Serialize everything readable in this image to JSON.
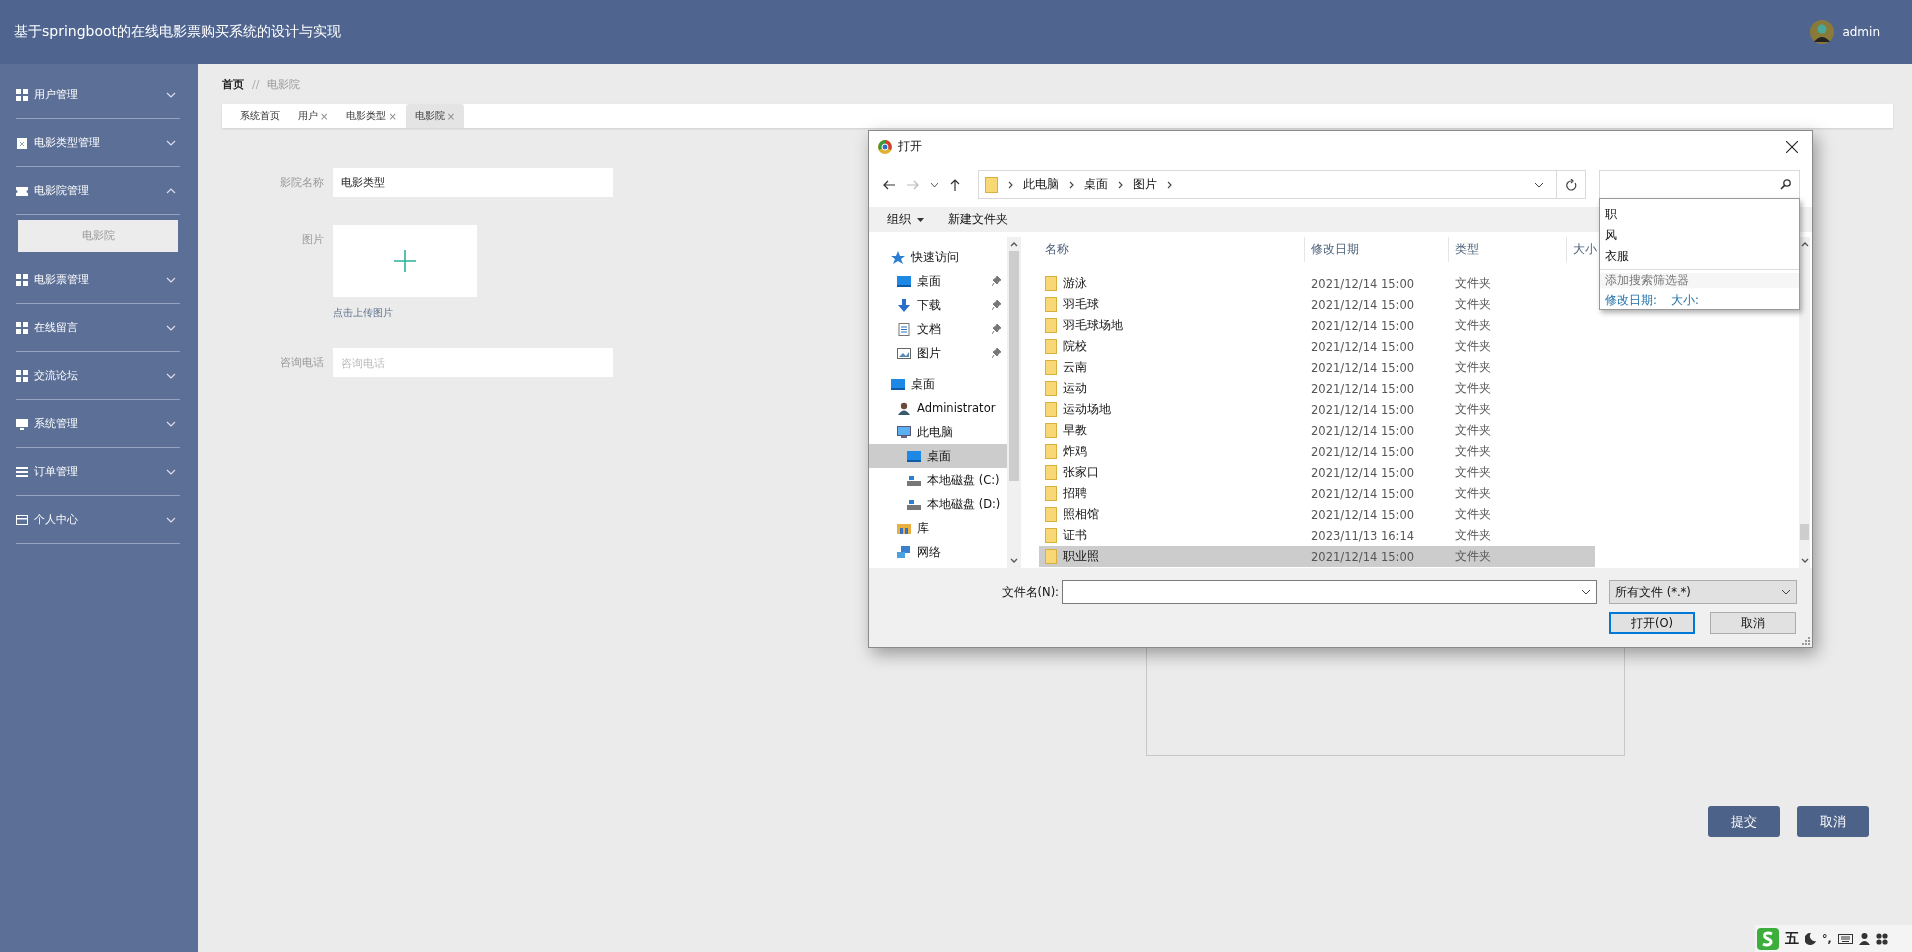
{
  "header": {
    "title": "基于springboot的在线电影票购买系统的设计与实现",
    "user": "admin"
  },
  "sidebar": [
    {
      "label": "用户管理",
      "kind": "grid",
      "expanded": false
    },
    {
      "label": "电影类型管理",
      "kind": "clipboard",
      "expanded": false
    },
    {
      "label": "电影院管理",
      "kind": "ticket",
      "expanded": true,
      "children": [
        {
          "label": "电影院",
          "selected": true
        }
      ]
    },
    {
      "label": "电影票管理",
      "kind": "grid",
      "expanded": false
    },
    {
      "label": "在线留言",
      "kind": "grid",
      "expanded": false
    },
    {
      "label": "交流论坛",
      "kind": "grid",
      "expanded": false
    },
    {
      "label": "系统管理",
      "kind": "monitor",
      "expanded": false
    },
    {
      "label": "订单管理",
      "kind": "list",
      "expanded": false
    },
    {
      "label": "个人中心",
      "kind": "card",
      "expanded": false
    }
  ],
  "breadcrumb": {
    "items": [
      "首页",
      "电影院"
    ],
    "separator": "//"
  },
  "tabs": [
    {
      "label": "系统首页",
      "selected": false
    },
    {
      "label": "用户",
      "close": "×",
      "selected": false
    },
    {
      "label": "电影类型",
      "close": "×",
      "selected": false
    },
    {
      "label": "电影院",
      "close": "×",
      "selected": true
    }
  ],
  "form": {
    "fields": [
      {
        "kind": "text",
        "label": "影院名称",
        "value": "电影类型"
      },
      {
        "kind": "upload",
        "label": "图片",
        "hint": "点击上传图片"
      },
      {
        "kind": "text",
        "label": "咨询电话",
        "placeholder": "咨询电话"
      }
    ],
    "buttons": [
      "提交",
      "取消"
    ]
  },
  "dialog": {
    "title": "打开",
    "path": [
      "此电脑",
      "桌面",
      "图片"
    ],
    "toolbar": {
      "organize": "组织",
      "new_folder": "新建文件夹"
    },
    "nav": [
      {
        "label": "快速访问",
        "kind": "star",
        "selected": false,
        "children": [
          {
            "label": "桌面",
            "kind": "desktop",
            "pinned": true,
            "selected": false
          },
          {
            "label": "下载",
            "kind": "download",
            "pinned": true,
            "selected": false
          },
          {
            "label": "文档",
            "kind": "document",
            "pinned": true,
            "selected": false
          },
          {
            "label": "图片",
            "kind": "picture",
            "pinned": true,
            "selected": false
          }
        ]
      },
      {
        "label": "桌面",
        "kind": "desktop",
        "selected": false,
        "children": [
          {
            "label": "Administrator",
            "kind": "user",
            "selected": false
          },
          {
            "label": "此电脑",
            "kind": "computer",
            "selected": false,
            "children": [
              {
                "label": "桌面",
                "kind": "desktop",
                "selected": true
              },
              {
                "label": "本地磁盘 (C:)",
                "kind": "drive",
                "selected": false
              },
              {
                "label": "本地磁盘 (D:)",
                "kind": "drive",
                "selected": false
              }
            ]
          },
          {
            "label": "库",
            "kind": "library",
            "selected": false
          },
          {
            "label": "网络",
            "kind": "network",
            "selected": false
          }
        ]
      }
    ],
    "columns": [
      "名称",
      "修改日期",
      "类型",
      "大小"
    ],
    "files": [
      {
        "name": "游泳",
        "date": "2021/12/14 15:00",
        "type": "文件夹",
        "selected": false
      },
      {
        "name": "羽毛球",
        "date": "2021/12/14 15:00",
        "type": "文件夹",
        "selected": false
      },
      {
        "name": "羽毛球场地",
        "date": "2021/12/14 15:00",
        "type": "文件夹",
        "selected": false
      },
      {
        "name": "院校",
        "date": "2021/12/14 15:00",
        "type": "文件夹",
        "selected": false
      },
      {
        "name": "云南",
        "date": "2021/12/14 15:00",
        "type": "文件夹",
        "selected": false
      },
      {
        "name": "运动",
        "date": "2021/12/14 15:00",
        "type": "文件夹",
        "selected": false
      },
      {
        "name": "运动场地",
        "date": "2021/12/14 15:00",
        "type": "文件夹",
        "selected": false
      },
      {
        "name": "早教",
        "date": "2021/12/14 15:00",
        "type": "文件夹",
        "selected": false
      },
      {
        "name": "炸鸡",
        "date": "2021/12/14 15:00",
        "type": "文件夹",
        "selected": false
      },
      {
        "name": "张家口",
        "date": "2021/12/14 15:00",
        "type": "文件夹",
        "selected": false
      },
      {
        "name": "招聘",
        "date": "2021/12/14 15:00",
        "type": "文件夹",
        "selected": false
      },
      {
        "name": "照相馆",
        "date": "2021/12/14 15:00",
        "type": "文件夹",
        "selected": false
      },
      {
        "name": "证书",
        "date": "2023/11/13 16:14",
        "type": "文件夹",
        "selected": false
      },
      {
        "name": "职业照",
        "date": "2021/12/14 15:00",
        "type": "文件夹",
        "selected": true
      }
    ],
    "search": {
      "suggestions": [
        "职",
        "风",
        "衣服"
      ],
      "filter_heading": "添加搜索筛选器",
      "filters": [
        "修改日期:",
        "大小:"
      ]
    },
    "filename_label": "文件名(N):",
    "file_type": "所有文件 (*.*)",
    "buttons": [
      {
        "label": "打开(O)",
        "kind": "default"
      },
      {
        "label": "取消",
        "kind": "normal"
      }
    ]
  },
  "ime": {
    "mode": "五",
    "punctuation": "°,"
  }
}
